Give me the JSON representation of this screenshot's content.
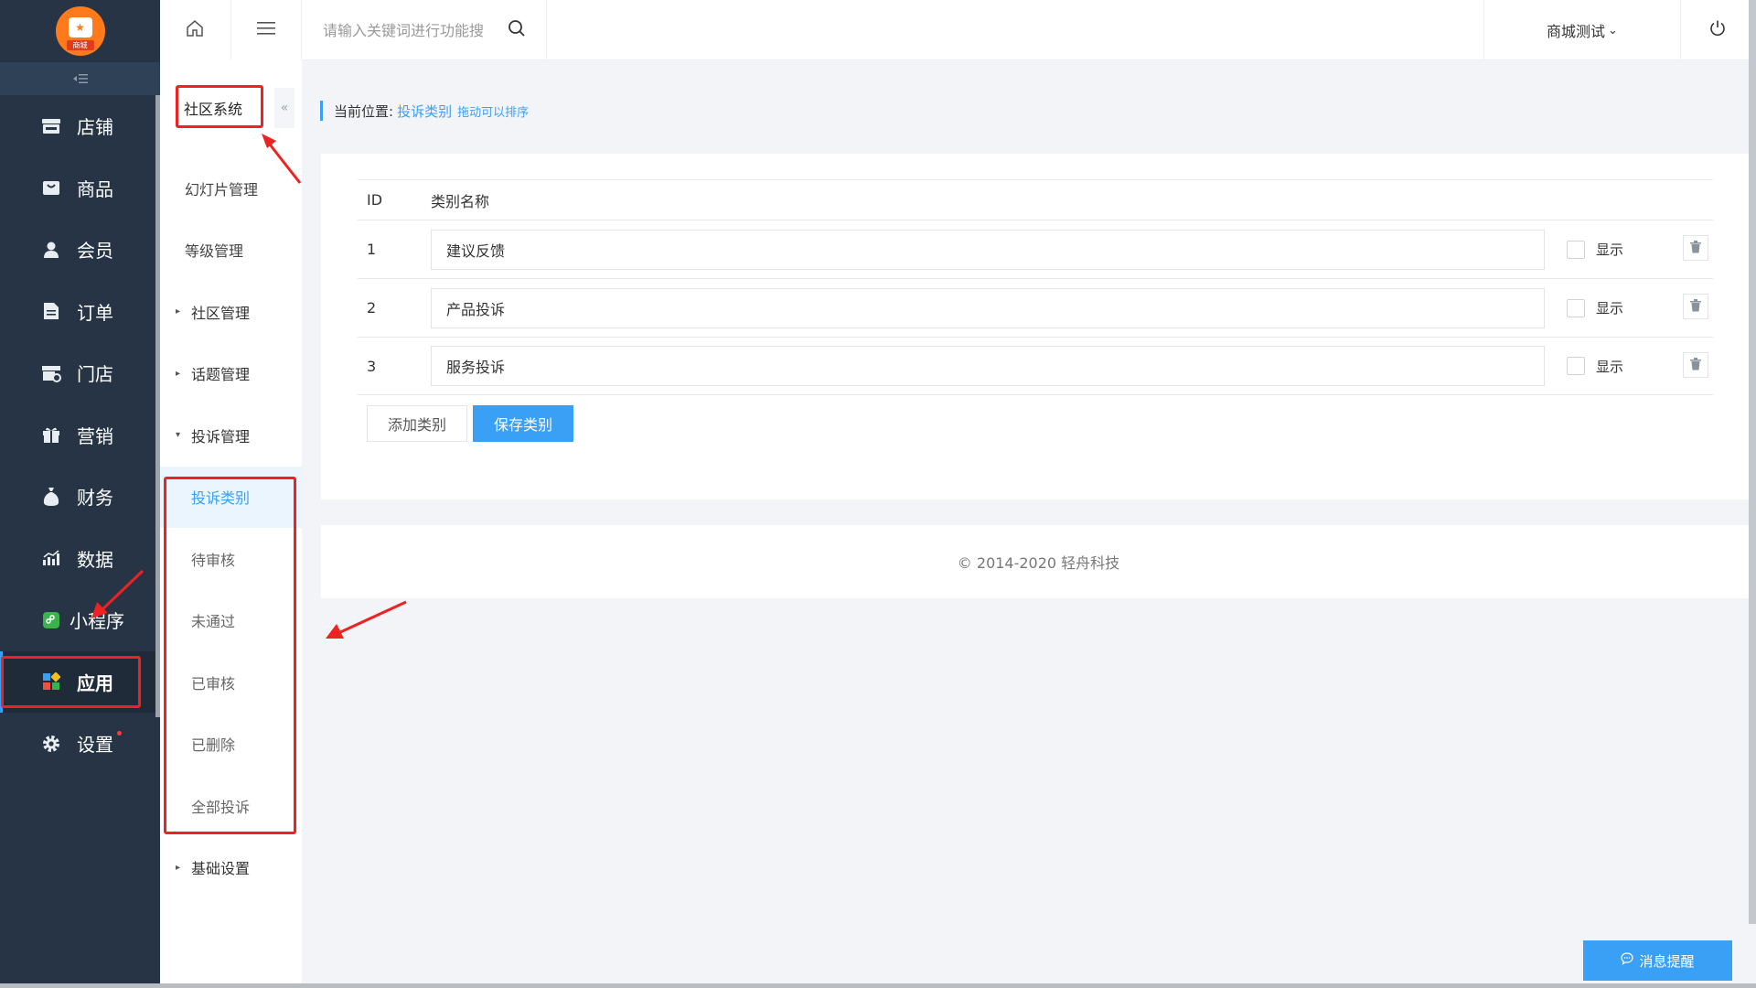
{
  "logo": {
    "tag": "商城"
  },
  "sidebar": {
    "items": [
      {
        "label": "店铺",
        "icon": "store-icon"
      },
      {
        "label": "商品",
        "icon": "bag-icon"
      },
      {
        "label": "会员",
        "icon": "user-icon"
      },
      {
        "label": "订单",
        "icon": "document-icon"
      },
      {
        "label": "门店",
        "icon": "shop-icon"
      },
      {
        "label": "营销",
        "icon": "gift-icon"
      },
      {
        "label": "财务",
        "icon": "money-bag-icon"
      },
      {
        "label": "数据",
        "icon": "bar-chart-icon"
      },
      {
        "label": "小程序",
        "icon": "mini-program-icon"
      },
      {
        "label": "应用",
        "icon": "apps-icon",
        "active": true
      },
      {
        "label": "设置",
        "icon": "gear-icon",
        "badge": true
      }
    ]
  },
  "subnav": {
    "title": "社区系统",
    "collapse_glyph": "«",
    "items": [
      {
        "label": "幻灯片管理"
      },
      {
        "label": "等级管理"
      },
      {
        "label": "社区管理",
        "caret": "▸"
      },
      {
        "label": "话题管理",
        "caret": "▸"
      },
      {
        "label": "投诉管理",
        "caret": "▾"
      },
      {
        "label": "投诉类别",
        "active": true
      },
      {
        "label": "待审核"
      },
      {
        "label": "未通过"
      },
      {
        "label": "已审核"
      },
      {
        "label": "已删除"
      },
      {
        "label": "全部投诉"
      },
      {
        "label": "基础设置",
        "caret": "▸"
      }
    ]
  },
  "topbar": {
    "search_placeholder": "请输入关键词进行功能搜",
    "shop_name": "商城测试",
    "shop_caret": "⌄"
  },
  "breadcrumb": {
    "label": "当前位置:",
    "current": "投诉类别",
    "hint": "拖动可以排序"
  },
  "table": {
    "headers": {
      "id": "ID",
      "name": "类别名称"
    },
    "rows": [
      {
        "id": "1",
        "name": "建议反馈",
        "show_label": "显示"
      },
      {
        "id": "2",
        "name": "产品投诉",
        "show_label": "显示"
      },
      {
        "id": "3",
        "name": "服务投诉",
        "show_label": "显示"
      }
    ]
  },
  "actions": {
    "add": "添加类别",
    "save": "保存类别"
  },
  "footer": {
    "copyright": "© 2014-2020 轻舟科技"
  },
  "message_button": {
    "label": "消息提醒"
  },
  "colors": {
    "accent": "#3aa0f5",
    "sidebar_bg": "#263445",
    "annotation_red": "#e22222"
  }
}
